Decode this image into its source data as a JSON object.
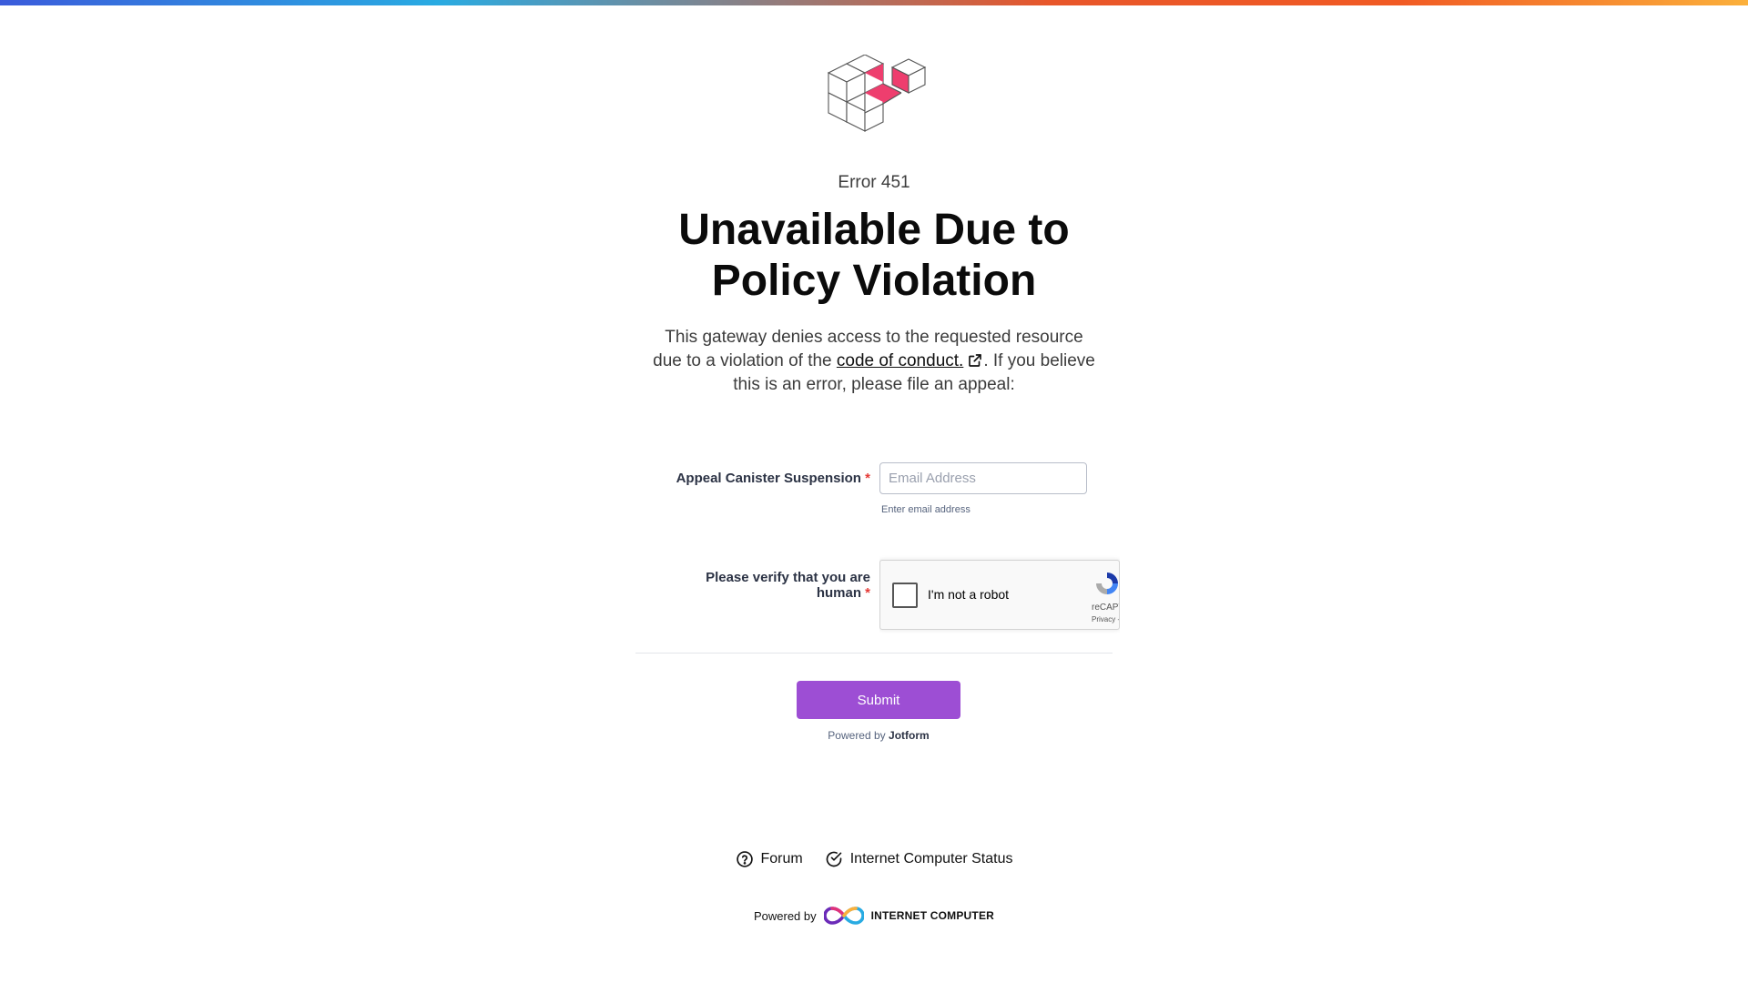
{
  "colors": {
    "accent_pink": "#ee3e6e",
    "submit_purple": "#9d4ed4",
    "required_red": "#e53935"
  },
  "logo": {
    "icon": "cubes-logo-icon"
  },
  "error": {
    "code": "Error 451",
    "title_line1": "Unavailable Due to",
    "title_line2": "Policy Violation",
    "desc_before": "This gateway denies access to the requested resource due to a violation of the ",
    "desc_link": "code of conduct.",
    "desc_after": ". If you believe this is an error, please file an appeal:"
  },
  "form": {
    "appeal_label": "Appeal Canister Suspension",
    "required_mark": "*",
    "email_placeholder": "Email Address",
    "email_value": "",
    "email_sublabel": "Enter email address",
    "verify_label_line1": "Please verify that you are",
    "verify_label_line2": "human",
    "captcha_label": "I'm not a robot",
    "captcha_brand": "reCAPTCHA",
    "captcha_links": "Privacy - Terms",
    "submit_label": "Submit",
    "powered_prefix": "Powered by",
    "powered_brand": "Jotform"
  },
  "footer": {
    "forum_label": "Forum",
    "status_label": "Internet Computer Status",
    "powered_prefix": "Powered by",
    "ic_brand": "INTERNET COMPUTER"
  }
}
